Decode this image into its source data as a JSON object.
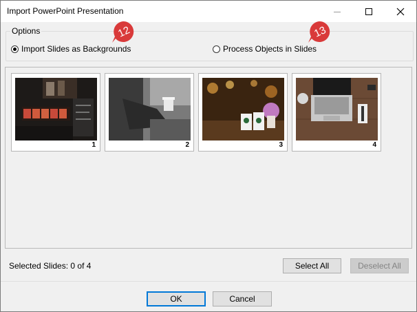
{
  "window": {
    "title": "Import PowerPoint Presentation"
  },
  "options": {
    "legend": "Options",
    "radio_backgrounds": {
      "label": "Import Slides as Backgrounds",
      "checked": true,
      "badge": "12"
    },
    "radio_objects": {
      "label": "Process Objects in Slides",
      "checked": false,
      "badge": "13"
    }
  },
  "slides": [
    {
      "number": "1"
    },
    {
      "number": "2"
    },
    {
      "number": "3"
    },
    {
      "number": "4"
    }
  ],
  "selection": {
    "label": "Selected Slides: 0 of 4",
    "select_all": "Select All",
    "deselect_all": "Deselect All"
  },
  "buttons": {
    "ok": "OK",
    "cancel": "Cancel"
  },
  "colors": {
    "badge_red": "#d93a3a",
    "accent_blue": "#0078d7"
  }
}
